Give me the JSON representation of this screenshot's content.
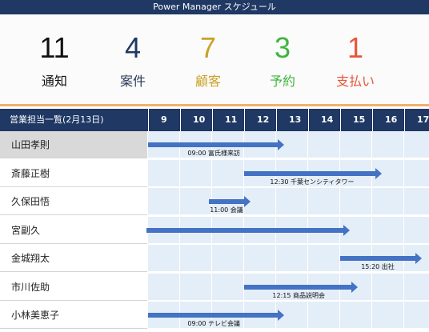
{
  "app_title": "Power Manager スケジュール",
  "stats": [
    {
      "value": "11",
      "label": "通知",
      "color": "#111111"
    },
    {
      "value": "4",
      "label": "案件",
      "color": "#1f3864"
    },
    {
      "value": "7",
      "label": "顧客",
      "color": "#c9a227"
    },
    {
      "value": "3",
      "label": "予約",
      "color": "#3cb53c"
    },
    {
      "value": "1",
      "label": "支払い",
      "color": "#e8563a"
    }
  ],
  "schedule": {
    "title": "営業担当一覧(2月13日)",
    "hours": [
      "9",
      "10",
      "11",
      "12",
      "13",
      "14",
      "15",
      "16",
      "17"
    ],
    "rows": [
      {
        "name": "山田孝則",
        "event": "09:00 富氏様来訪",
        "start": 9.0,
        "end": 13.25
      },
      {
        "name": "斎藤正樹",
        "event": "12:30 千葉センシティタワー",
        "start": 12.0,
        "end": 16.3
      },
      {
        "name": "久保田悟",
        "event": "11:00 会議",
        "start": 10.9,
        "end": 12.2
      },
      {
        "name": "宮副久",
        "event": "",
        "start": 8.95,
        "end": 15.3
      },
      {
        "name": "金城翔太",
        "event": "15:20 出社",
        "start": 15.0,
        "end": 17.55
      },
      {
        "name": "市川佐助",
        "event": "12:15 商品説明会",
        "start": 12.0,
        "end": 15.55
      },
      {
        "name": "小林美恵子",
        "event": "09:00 テレビ会議",
        "start": 9.0,
        "end": 13.25
      }
    ]
  },
  "colors": {
    "header": "#1f3864",
    "accent_line": "#f3b06b",
    "bar": "#4472c4",
    "timeline_bg": "#e4eef8"
  }
}
